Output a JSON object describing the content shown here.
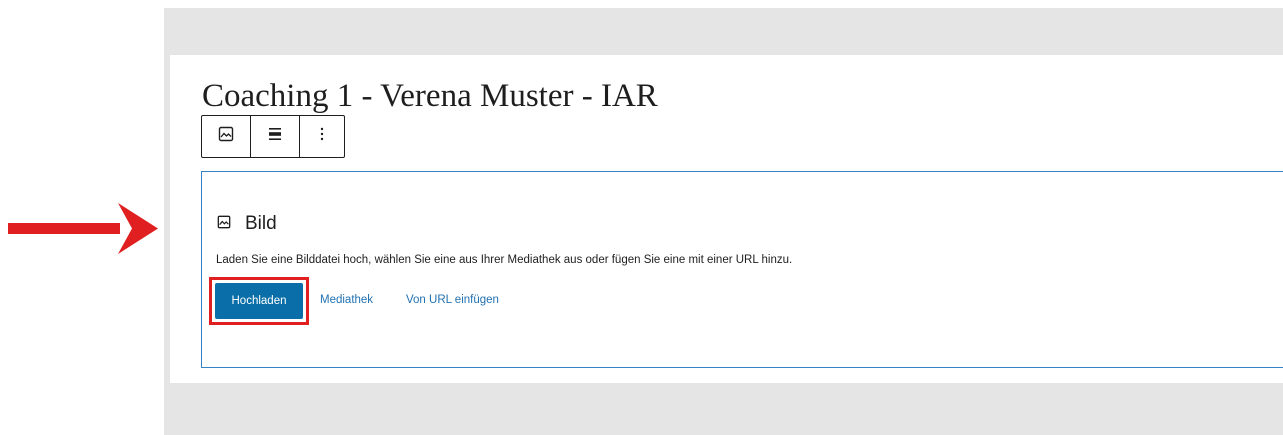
{
  "post": {
    "title": "Coaching 1 - Verena Muster - IAR"
  },
  "toolbar": {
    "items": [
      {
        "icon": "image-icon"
      },
      {
        "icon": "align-center-icon"
      },
      {
        "icon": "more-options-icon"
      }
    ]
  },
  "image_block": {
    "icon": "image-icon",
    "title": "Bild",
    "instructions": "Laden Sie eine Bilddatei hoch, wählen Sie eine aus Ihrer Mediathek aus oder fügen Sie eine mit einer URL hinzu.",
    "upload_label": "Hochladen",
    "media_library_label": "Mediathek",
    "insert_url_label": "Von URL einfügen"
  },
  "annotations": {
    "arrow_icon": "arrow-right-icon",
    "highlight_color": "#e02020"
  },
  "colors": {
    "accent": "#0a6fa8",
    "link": "#2271b1",
    "block_border": "#3582c4",
    "frame": "#e5e5e5"
  }
}
